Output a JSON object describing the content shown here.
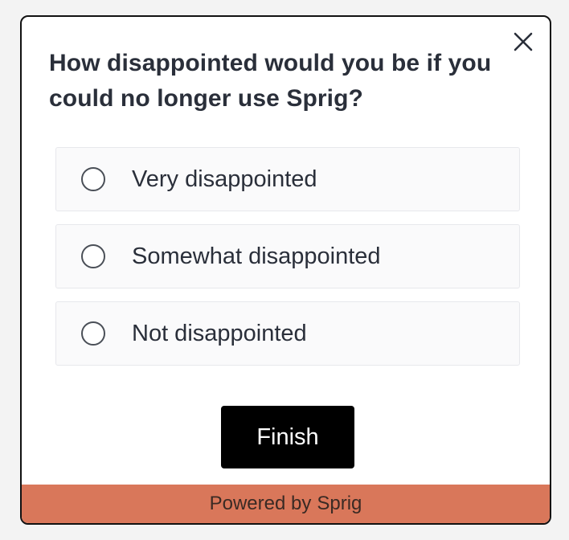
{
  "survey": {
    "question": "How disappointed would you be if you could no longer use Sprig?",
    "options": [
      {
        "label": "Very disappointed",
        "selected": false
      },
      {
        "label": "Somewhat disappointed",
        "selected": false
      },
      {
        "label": "Not disappointed",
        "selected": false
      }
    ],
    "finish_label": "Finish"
  },
  "footer": {
    "powered_by": "Powered by",
    "brand": "Sprig"
  },
  "icons": {
    "close": "close-icon",
    "radio": "radio-unchecked-icon"
  },
  "colors": {
    "footer_bg": "#d9775a",
    "button_bg": "#000000",
    "text": "#2a2f3a"
  }
}
